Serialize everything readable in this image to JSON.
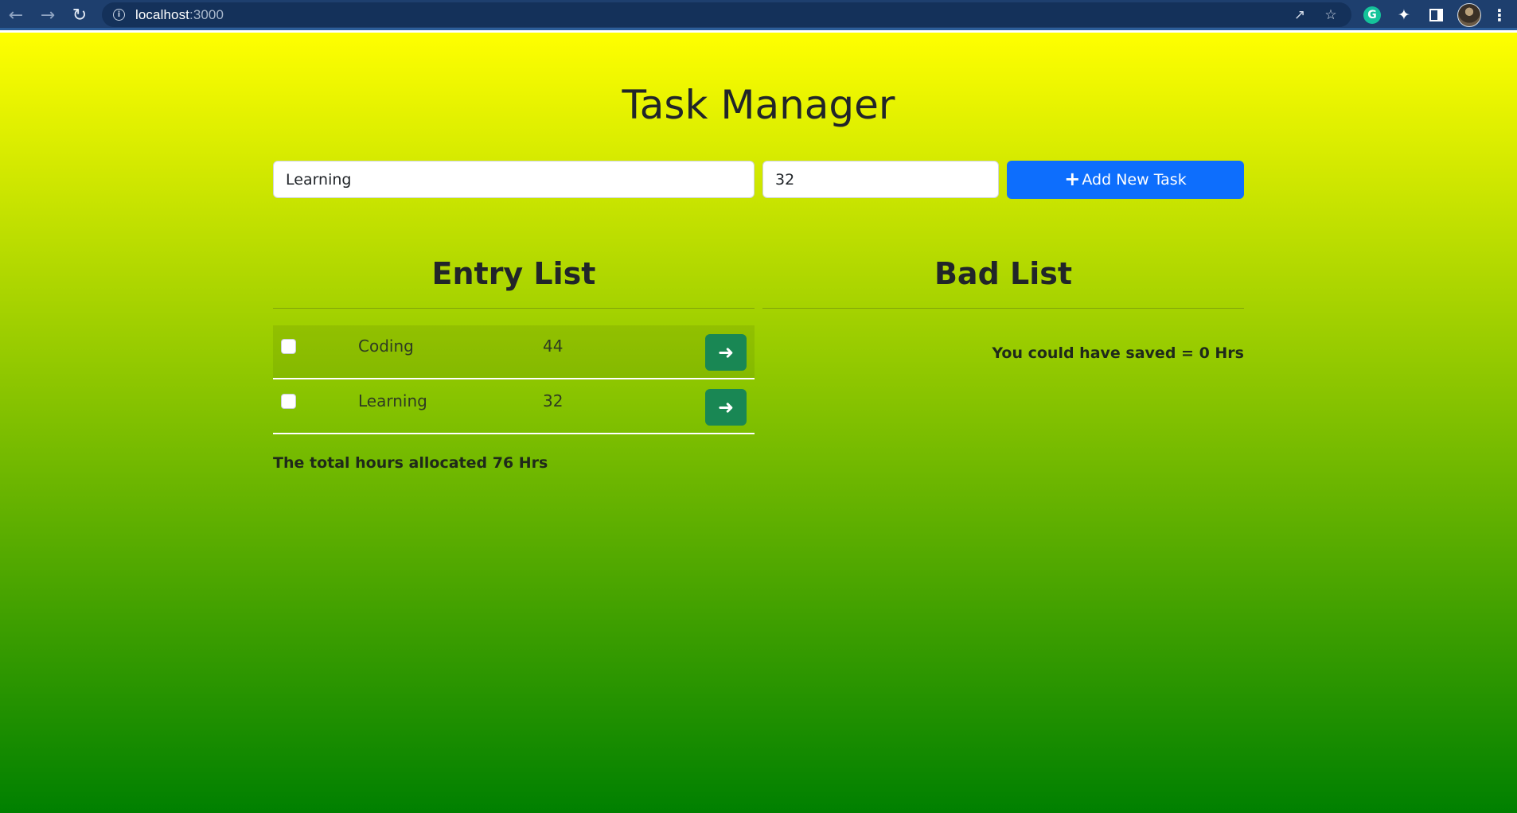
{
  "browser": {
    "url_host": "localhost",
    "url_port": ":3000",
    "icons": {
      "back": "back-arrow-icon",
      "forward": "forward-arrow-icon",
      "reload": "reload-icon",
      "info": "info-icon",
      "share": "share-icon",
      "bookmark": "star-icon",
      "grammarly": "grammarly-icon",
      "extensions": "puzzle-icon",
      "side_panel": "side-panel-icon",
      "menu": "more-vert-icon"
    },
    "grammarly_letter": "G"
  },
  "page": {
    "title": "Task Manager",
    "background_gradient": [
      "#ffff00",
      "#008000"
    ]
  },
  "form": {
    "task_value": "Learning",
    "hours_value": "32",
    "add_button_label": "Add New Task",
    "add_button_color": "#0d6efd"
  },
  "entry_list": {
    "heading": "Entry List",
    "rows": [
      {
        "task": "Coding",
        "hours": "44",
        "checked": false
      },
      {
        "task": "Learning",
        "hours": "32",
        "checked": false
      }
    ],
    "move_button_color": "#198754",
    "total_text": "The total hours allocated 76 Hrs"
  },
  "bad_list": {
    "heading": "Bad List",
    "saved_text": "You could have saved = 0 Hrs"
  }
}
